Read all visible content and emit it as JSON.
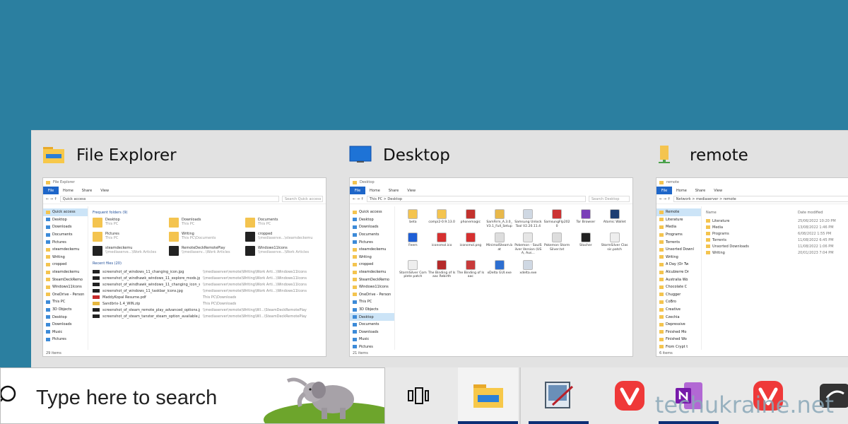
{
  "switcher": {
    "windows": [
      {
        "title": "File Explorer",
        "ribbon": [
          "File",
          "Home",
          "Share",
          "View"
        ],
        "titlebar": "File Explorer",
        "address": "Quick access",
        "search_placeholder": "Search Quick access",
        "nav": [
          "Quick access",
          "Desktop",
          "Downloads",
          "Documents",
          "Pictures",
          "steamdeckemu",
          "Writing",
          "cropped",
          "steamdeckemu",
          "SteamDeckRemo",
          "Windows11Icons",
          "OneDrive - Person",
          "This PC",
          "3D Objects",
          "Desktop",
          "Downloads",
          "Music",
          "Pictures"
        ],
        "frequent_heading": "Frequent folders (9)",
        "frequent": [
          {
            "name": "Desktop",
            "sub": "This PC"
          },
          {
            "name": "Downloads",
            "sub": "This PC"
          },
          {
            "name": "Documents",
            "sub": "This PC"
          },
          {
            "name": "Pictures",
            "sub": "This PC"
          },
          {
            "name": "Writing",
            "sub": "This PC\\Documents"
          },
          {
            "name": "cropped",
            "sub": "\\\\mediaserve...\\steamdeckemu"
          },
          {
            "name": "steamdeckemu",
            "sub": "\\\\mediaserve...\\Work Articles"
          },
          {
            "name": "RemoteDeckRemotePlay",
            "sub": "\\\\mediaserv...\\Work Articles"
          },
          {
            "name": "Windows11Icons",
            "sub": "\\\\mediaserve...\\Work Articles"
          }
        ],
        "recent_heading": "Recent files (20)",
        "recent": [
          {
            "name": "screenshot_of_windows_11_changing_icon.jpg",
            "path": "\\\\mediaserver\\remote\\Writing\\Work Arti...\\Windows11Icons"
          },
          {
            "name": "screenshot_of_windhawk_windows_11_explore_mods.jpg",
            "path": "\\\\mediaserver\\remote\\Writing\\Work Arti...\\Windows11Icons"
          },
          {
            "name": "screenshot_of_windhawk_windows_11_changing_icon_size...",
            "path": "\\\\mediaserver\\remote\\Writing\\Work Arti...\\Windows11Icons"
          },
          {
            "name": "screenshot_of_windows_11_taskbar_icons.jpg",
            "path": "\\\\mediaserver\\remote\\Writing\\Work Arti...\\Windows11Icons"
          },
          {
            "name": "MaddyKopal Resume.pdf",
            "path": "This PC\\Downloads"
          },
          {
            "name": "Sandbrix-1.4_WIN.zip",
            "path": "This PC\\Downloads"
          },
          {
            "name": "screenshot_of_steam_remote_play_advanced_options.jpg",
            "path": "\\\\mediaserver\\remote\\Writing\\Wl...\\SteamDeckRemotePlay"
          },
          {
            "name": "screenshot_of_steam_tanster_steam_option_available.jpg",
            "path": "\\\\mediaserver\\remote\\Writing\\Wl...\\SteamDeckRemotePlay"
          }
        ],
        "status": "29 items"
      },
      {
        "title": "Desktop",
        "ribbon": [
          "File",
          "Home",
          "Share",
          "View"
        ],
        "titlebar": "Desktop",
        "address": "This PC > Desktop",
        "search_placeholder": "Search Desktop",
        "nav": [
          "Quick access",
          "Desktop",
          "Downloads",
          "Documents",
          "Pictures",
          "steamdeckemu",
          "Writing",
          "cropped",
          "steamdeckemu",
          "SteamDeckRemo",
          "Windows11Icons",
          "OneDrive - Person",
          "This PC",
          "3D Objects",
          "Desktop",
          "Documents",
          "Downloads",
          "Music",
          "Pictures"
        ],
        "items": [
          "beta",
          "compi2-0.9.13.0",
          "phonemagic",
          "SamFirm_A.3.0_V3.1_Full_Setup",
          "Samsung Unlock Tool V2.20.11.4",
          "SamsungFlp2020",
          "Tor Browser",
          "Atomic Wallet",
          "Feem",
          "iconsmol.ico",
          "iconsmol.png",
          "MinimalSteam.bat",
          "Pokemon - SoulSilver Version (USA, Aus...",
          "Pokemon Storm Silver.txt",
          "Stacher",
          "StormSilver Classic.patch",
          "StormSilver Complete patch",
          "The Binding of Isaac Rebirth",
          "The Binding of Isaac",
          "xDelta GUI.exe",
          "xdelta.exe"
        ],
        "status": "21 items"
      },
      {
        "title": "remote",
        "ribbon": [
          "File",
          "Home",
          "Share",
          "View"
        ],
        "titlebar": "remote",
        "address": "Network > mediaserver > remote",
        "nav": [
          "Remote",
          "Literature",
          "Media",
          "Programs",
          "Torrents",
          "Unsorted Downl",
          "Writing",
          "A Day (Or Tw",
          "Alcubierre Dr",
          "Australia Wo",
          "Chocolate C",
          "Chugger",
          "CoBro",
          "Creative",
          "Czechia",
          "Depressive",
          "Finished Mo",
          "Finished Wo",
          "From Crypt t"
        ],
        "columns": [
          "Name",
          "Date modified"
        ],
        "rows": [
          {
            "name": "Literature",
            "date": "25/06/2022 10:20 PM"
          },
          {
            "name": "Media",
            "date": "13/08/2022 1:46 PM"
          },
          {
            "name": "Programs",
            "date": "6/08/2022 1:55 PM"
          },
          {
            "name": "Torrents",
            "date": "11/08/2022 6:45 PM"
          },
          {
            "name": "Unsorted Downloads",
            "date": "11/08/2022 1:06 PM"
          },
          {
            "name": "Writing",
            "date": "20/01/2023 7:04 PM"
          }
        ],
        "status": "6 items"
      }
    ]
  },
  "taskbar": {
    "search_placeholder": "Type here to search",
    "watermark": "techukraine.net",
    "colors": {
      "accent": "#0d2f76",
      "desktop_bg": "#2b7fa0"
    }
  }
}
